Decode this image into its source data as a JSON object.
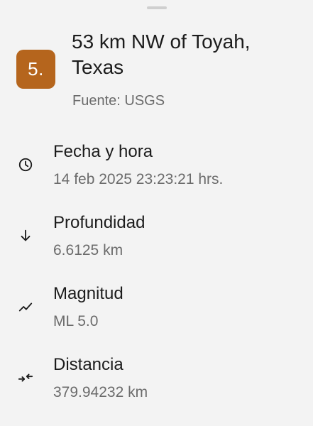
{
  "sheet": {
    "magnitude_badge": "5.",
    "title_line1": "53 km NW of Toyah,",
    "title_line2": "Texas",
    "source": "Fuente: USGS",
    "badge_color": "#b5651d"
  },
  "details": [
    {
      "icon": "clock-icon",
      "label": "Fecha y hora",
      "value": "14 feb 2025 23:23:21 hrs."
    },
    {
      "icon": "arrow-down-icon",
      "label": "Profundidad",
      "value": "6.6125 km"
    },
    {
      "icon": "trending-icon",
      "label": "Magnitud",
      "value": "ML 5.0"
    },
    {
      "icon": "compress-arrows-icon",
      "label": "Distancia",
      "value": "379.94232 km"
    }
  ]
}
